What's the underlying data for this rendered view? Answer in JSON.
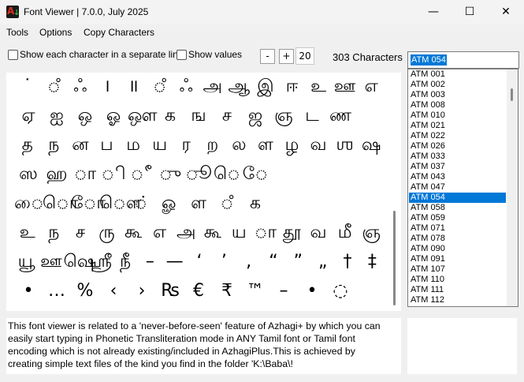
{
  "window": {
    "title": "Font Viewer | 7.0.0, July 2025",
    "icon_letters": [
      "A",
      "↓"
    ],
    "controls": {
      "minimize": "—",
      "maximize": "☐",
      "close": "✕"
    }
  },
  "menu": [
    "Tools",
    "Options",
    "Copy Characters"
  ],
  "toolbar": {
    "checkbox1_label": "Show each character in a separate line",
    "checkbox1_checked": false,
    "checkbox2_label": "Show values",
    "checkbox2_checked": false,
    "minus_label": "-",
    "plus_label": "+",
    "font_size": "20",
    "char_count": "303 Characters"
  },
  "combo": {
    "selected": "ATM 054"
  },
  "glyph_rows": [
    [
      "˙",
      "ஂ",
      "ஃ",
      "।",
      "॥",
      "ஂ",
      "ஃ",
      "அ",
      "ஆ",
      "இ",
      "ஈ",
      "உ",
      "ஊ",
      "எ"
    ],
    [
      "ஏ",
      "ஐ",
      "ஒ",
      "ஓ",
      "ஔ",
      "க",
      "ங",
      "ச",
      "ஜ",
      "ஞ",
      "ட",
      "ண"
    ],
    [
      "த",
      "ந",
      "ன",
      "ப",
      "ம",
      "ய",
      "ர",
      "ற",
      "ல",
      "ள",
      "ழ",
      "வ",
      "ஶ",
      "ஷ"
    ],
    [
      "ஸ",
      "ஹ",
      "ா",
      "ி",
      "ீ",
      "ு",
      "ூ",
      "ெ",
      "ே"
    ],
    [
      "ை",
      "ொ",
      "ோ",
      "ௌ",
      "்",
      "ௐ",
      "ள",
      "ஂ",
      "க"
    ],
    [
      "உ",
      "ந",
      "ச",
      "ரு",
      "கூ",
      "எ",
      "அ",
      "கூ",
      "ய",
      "ா",
      "தூ",
      "வ",
      "மீ",
      "ஞ"
    ],
    [
      "யூ",
      "ஊ",
      "ஷெ",
      "ஸ்ரீ",
      "நீ",
      "–",
      "—",
      "‘",
      "’",
      ",",
      "“",
      "”",
      "„",
      "†",
      "‡"
    ],
    [
      "•",
      "…",
      "%",
      "‹",
      "›",
      "₨",
      "€",
      "₹",
      "™",
      "–",
      "•",
      "◌"
    ]
  ],
  "font_list": {
    "items": [
      "ATM 001",
      "ATM 002",
      "ATM 003",
      "ATM 008",
      "ATM 010",
      "ATM 021",
      "ATM 022",
      "ATM 026",
      "ATM 033",
      "ATM 037",
      "ATM 043",
      "ATM 047",
      "ATM 054",
      "ATM 058",
      "ATM 059",
      "ATM 071",
      "ATM 078",
      "ATM 090",
      "ATM 091",
      "ATM 107",
      "ATM 110",
      "ATM 111",
      "ATM 112"
    ],
    "selected": "ATM 054"
  },
  "description": "This font viewer is related to a 'never-before-seen' feature of Azhagi+ by which you can easily start typing in Phonetic Transliteration mode in ANY Tamil font or Tamil font encoding which is not already existing/included in AzhagiPlus.This is achieved by creating simple text files of the kind you find in the folder 'K:\\Baba\\!",
  "colors": {
    "accent": "#0078d7",
    "window_bg": "#f0f0f0",
    "panel_bg": "#ffffff"
  }
}
